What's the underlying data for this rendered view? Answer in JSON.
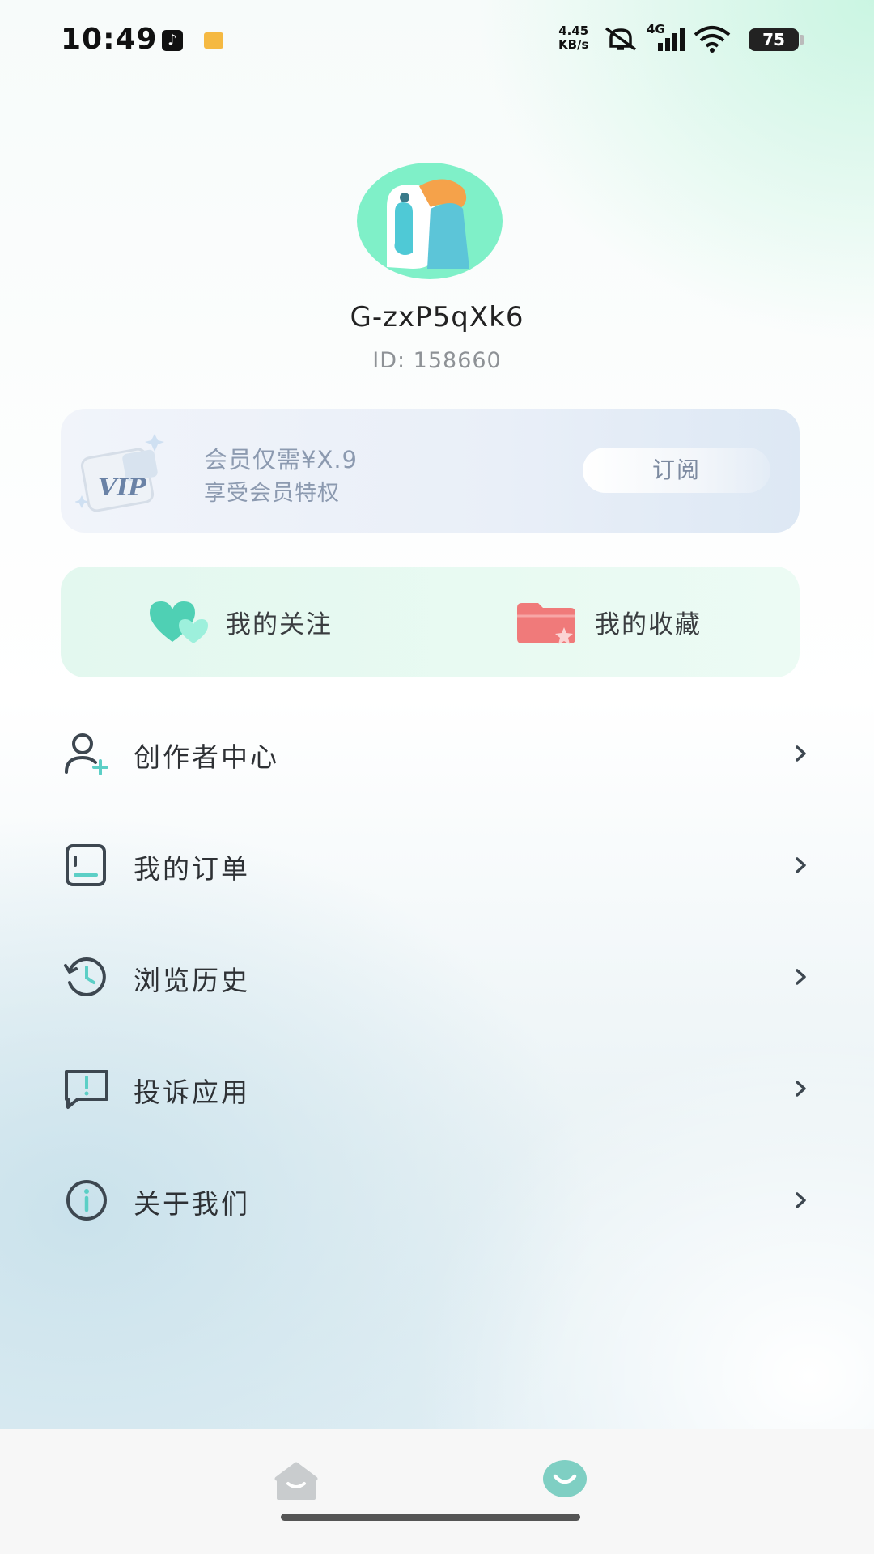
{
  "status_bar": {
    "time": "10:49",
    "speed_value": "4.45",
    "speed_unit": "KB/s",
    "network": "4G",
    "battery": "75",
    "icons": [
      "tiktok-icon",
      "message-icon",
      "mute-icon",
      "signal-icon",
      "wifi-icon",
      "battery-icon"
    ]
  },
  "profile": {
    "username": "G-zxP5qXk6",
    "user_id": "ID: 158660"
  },
  "vip": {
    "line1": "会员仅需¥X.9",
    "line2": "享受会员特权",
    "subscribe_label": "订阅",
    "badge_text": "VIP"
  },
  "shortcuts": {
    "follow_label": "我的关注",
    "collect_label": "我的收藏"
  },
  "menu": {
    "items": [
      {
        "label": "创作者中心",
        "icon": "user-add-icon"
      },
      {
        "label": "我的订单",
        "icon": "order-icon"
      },
      {
        "label": "浏览历史",
        "icon": "history-icon"
      },
      {
        "label": "投诉应用",
        "icon": "report-icon"
      },
      {
        "label": "关于我们",
        "icon": "info-icon"
      }
    ]
  },
  "bottom_nav": {
    "items": [
      {
        "name": "home",
        "icon": "home-icon",
        "active": false
      },
      {
        "name": "mine",
        "icon": "smile-icon",
        "active": true
      }
    ]
  },
  "colors": {
    "accent": "#5ccfc6",
    "icon_stroke": "#3d4750",
    "vip_text": "#8c9ab0",
    "follow_heart": "#4fd0b4",
    "collect_folder": "#f07a7a"
  }
}
